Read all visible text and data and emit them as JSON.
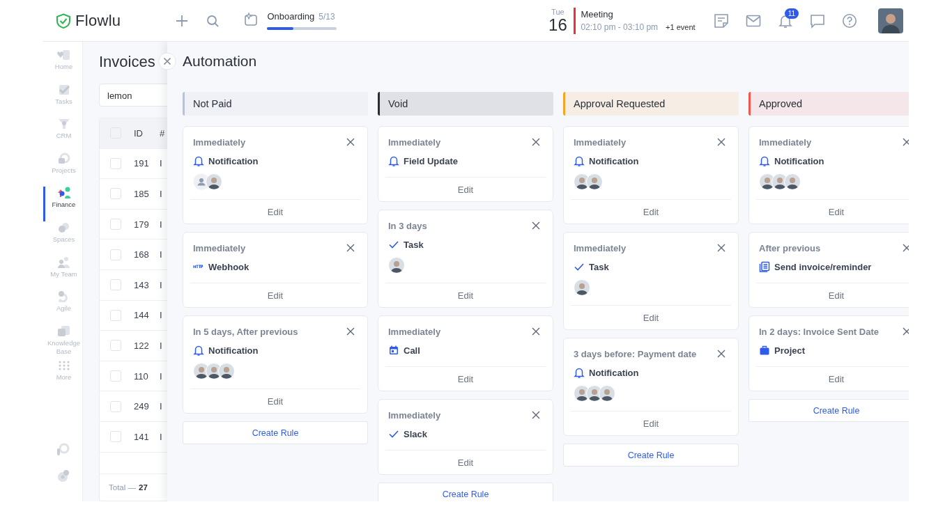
{
  "header": {
    "logo": "Flowlu",
    "onboarding": {
      "label": "Onboarding",
      "count": "5/13",
      "level": 0.38
    },
    "calendar": {
      "weekday": "Tue",
      "day": "16",
      "event_title": "Meeting",
      "event_time": "02:10 pm - 03:10 pm",
      "more": "+1 event"
    },
    "notification_count": "11"
  },
  "sidebar": {
    "items": [
      {
        "label": "Home",
        "selected": false
      },
      {
        "label": "Tasks",
        "selected": false
      },
      {
        "label": "CRM",
        "selected": false
      },
      {
        "label": "Projects",
        "selected": false
      },
      {
        "label": "Finance",
        "selected": true
      },
      {
        "label": "Spaces",
        "selected": false
      },
      {
        "label": "My Team",
        "selected": false
      },
      {
        "label": "Agile",
        "selected": false
      },
      {
        "label": "Knowledge Base",
        "selected": false
      },
      {
        "label": "More",
        "selected": false
      }
    ]
  },
  "invoices": {
    "title": "Invoices",
    "search": "lemon",
    "columns": [
      "ID",
      "#"
    ],
    "all_checked": false,
    "rows": [
      {
        "checked": false,
        "id": "191",
        "column_2": "I"
      },
      {
        "checked": false,
        "id": "185",
        "column_2": "I"
      },
      {
        "checked": false,
        "id": "179",
        "column_2": "I"
      },
      {
        "checked": false,
        "id": "168",
        "column_2": "I"
      },
      {
        "checked": false,
        "id": "143",
        "column_2": "I"
      },
      {
        "checked": false,
        "id": "144",
        "column_2": "I"
      },
      {
        "checked": false,
        "id": "122",
        "column_2": "I"
      },
      {
        "checked": false,
        "id": "110",
        "column_2": "I"
      },
      {
        "checked": false,
        "id": "249",
        "column_2": "I"
      },
      {
        "checked": false,
        "id": "141",
        "column_2": "I"
      }
    ],
    "total_label": "Total —",
    "total": "27"
  },
  "automation": {
    "title": "Automation",
    "columns": [
      {
        "title": "Not Paid",
        "color": "#b9c3d1",
        "create_label": "Create Rule",
        "rules": [
          {
            "trigger": "Immediately",
            "action": "Notification",
            "kind": "notification",
            "avatars": [
              {
                "kind": "placeholder"
              },
              {
                "kind": "photo"
              }
            ],
            "edit": "Edit"
          },
          {
            "trigger": "Immediately",
            "action": "Webhook",
            "kind": "webhook",
            "edit": "Edit"
          },
          {
            "trigger": "In 5 days, After previous",
            "action": "Notification",
            "kind": "notification",
            "avatars": [
              {
                "kind": "photo"
              },
              {
                "kind": "photo"
              },
              {
                "kind": "photo"
              }
            ],
            "edit": "Edit"
          }
        ]
      },
      {
        "title": "Void",
        "color": "#2a2d33",
        "create_label": "Create Rule",
        "rules": [
          {
            "trigger": "Immediately",
            "action": "Field Update",
            "kind": "notification",
            "edit": "Edit"
          },
          {
            "trigger": "In 3 days",
            "action": "Task",
            "kind": "task",
            "avatars": [
              {
                "kind": "photo"
              }
            ],
            "edit": "Edit"
          },
          {
            "trigger": "Immediately",
            "action": "Call",
            "kind": "call",
            "edit": "Edit"
          },
          {
            "trigger": "Immediately",
            "action": "Slack",
            "kind": "task",
            "edit": "Edit"
          }
        ]
      },
      {
        "title": "Approval Requested",
        "color": "#f5a524",
        "create_label": "Create Rule",
        "rules": [
          {
            "trigger": "Immediately",
            "action": "Notification",
            "kind": "notification",
            "avatars": [
              {
                "kind": "photo"
              },
              {
                "kind": "photo"
              }
            ],
            "edit": "Edit"
          },
          {
            "trigger": "Immediately",
            "action": "Task",
            "kind": "task",
            "avatars": [
              {
                "kind": "photo"
              }
            ],
            "edit": "Edit"
          },
          {
            "trigger": "3 days before: Payment date",
            "action": "Notification",
            "kind": "notification",
            "avatars": [
              {
                "kind": "photo"
              },
              {
                "kind": "photo"
              },
              {
                "kind": "photo"
              }
            ],
            "edit": "Edit"
          }
        ]
      },
      {
        "title": "Approved",
        "color": "#f0584f",
        "create_label": "Create Rule",
        "rules": [
          {
            "trigger": "Immediately",
            "action": "Notification",
            "kind": "notification",
            "avatars": [
              {
                "kind": "photo"
              },
              {
                "kind": "photo"
              },
              {
                "kind": "photo"
              }
            ],
            "edit": "Edit"
          },
          {
            "trigger": "After previous",
            "action": "Send invoice/reminder",
            "kind": "invoice",
            "edit": "Edit"
          },
          {
            "trigger": "In 2 days: Invoice Sent Date",
            "action": "Project",
            "kind": "project",
            "edit": "Edit"
          }
        ]
      }
    ]
  }
}
